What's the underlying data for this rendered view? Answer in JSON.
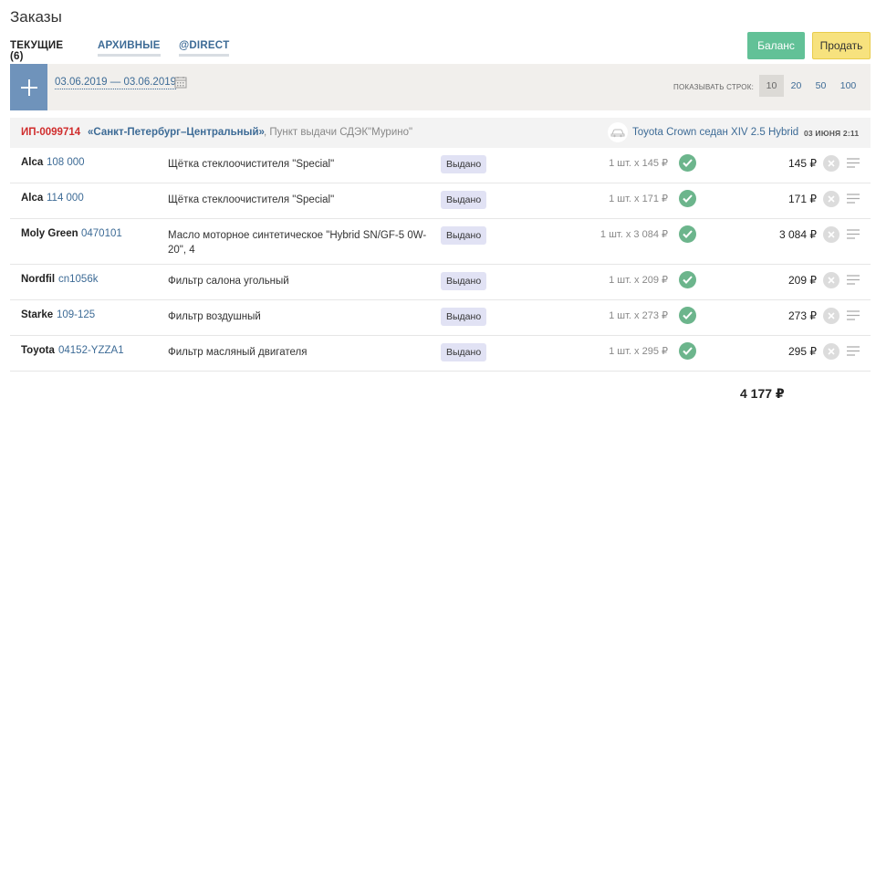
{
  "page": {
    "title": "Заказы"
  },
  "tabs": [
    {
      "label": "ТЕКУЩИЕ (6)",
      "active": true
    },
    {
      "label": "АРХИВНЫЕ",
      "active": false
    },
    {
      "label": "@DIRECT",
      "active": false
    }
  ],
  "buttons": {
    "balance": "Баланс",
    "sell": "Продать"
  },
  "filter": {
    "date_range": "03.06.2019 — 03.06.2019",
    "rows_label": "показывать строк:",
    "rows_options": [
      "10",
      "20",
      "50",
      "100"
    ],
    "rows_selected": "10"
  },
  "order": {
    "id": "ИП-0099714",
    "city": "«Санкт-Петербург–Центральный»",
    "pickup": ", Пункт выдачи СДЭК\"Мурино\"",
    "car": "Toyota Crown седан XIV 2.5 Hybrid",
    "date": "03 июня 2:11",
    "items": [
      {
        "brand": "Alca",
        "part": "108 000",
        "desc": "Щётка стеклоочистителя \"Special\"",
        "status": "Выдано",
        "qty": "1 шт. x 145 ₽",
        "price": "145 ₽"
      },
      {
        "brand": "Alca",
        "part": "114 000",
        "desc": "Щётка стеклоочистителя \"Special\"",
        "status": "Выдано",
        "qty": "1 шт. x 171 ₽",
        "price": "171 ₽"
      },
      {
        "brand": "Moly Green",
        "part": "0470101",
        "desc": "Масло моторное синтетическое \"Hybrid SN/GF-5 0W-20\", 4",
        "status": "Выдано",
        "qty": "1 шт. x 3 084 ₽",
        "price": "3 084 ₽"
      },
      {
        "brand": "Nordfil",
        "part": "cn1056k",
        "desc": "Фильтр салона угольный",
        "status": "Выдано",
        "qty": "1 шт. x 209 ₽",
        "price": "209 ₽"
      },
      {
        "brand": "Starke",
        "part": "109-125",
        "desc": "Фильтр воздушный",
        "status": "Выдано",
        "qty": "1 шт. x 273 ₽",
        "price": "273 ₽"
      },
      {
        "brand": "Toyota",
        "part": "04152-YZZA1",
        "desc": "Фильтр масляный двигателя",
        "status": "Выдано",
        "qty": "1 шт. x 295 ₽",
        "price": "295 ₽"
      }
    ],
    "total": "4 177 ₽"
  },
  "colors": {
    "accent_blue": "#3d6b96",
    "balance_green": "#62c197",
    "sell_yellow": "#f7e27e",
    "order_red": "#d02d2d",
    "check_green": "#6cb58c",
    "status_bg": "#e1e2f4"
  },
  "icons": {
    "add": "plus-icon",
    "calendar": "calendar-icon",
    "car": "car-icon",
    "status_ok": "check-icon",
    "remove": "close-icon",
    "menu": "menu-lines-icon"
  }
}
